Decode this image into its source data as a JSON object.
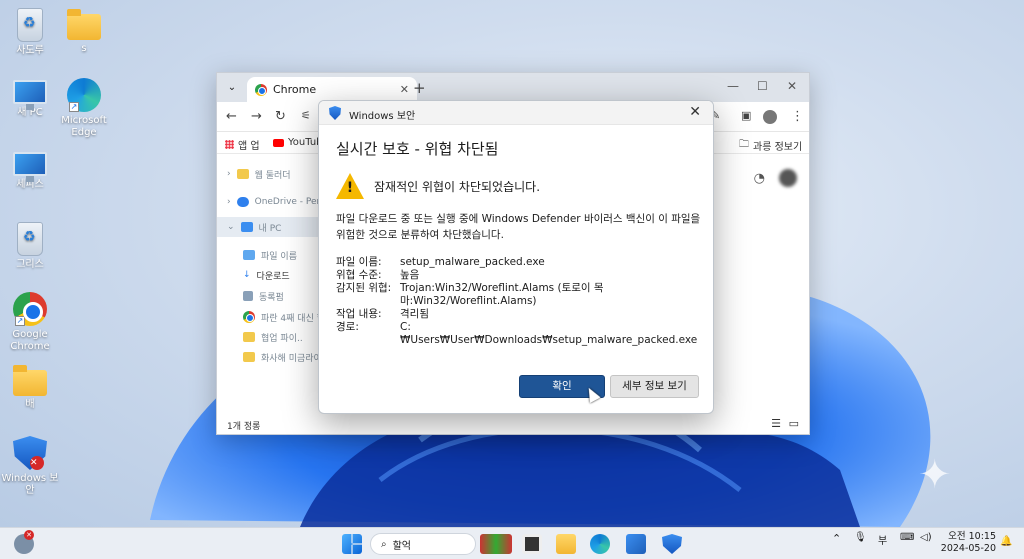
{
  "desktop": {
    "icons": [
      {
        "label": "사도루"
      },
      {
        "label": "s"
      },
      {
        "label": "새 PC"
      },
      {
        "label": "Microsoft Edge"
      },
      {
        "label": "세피스"
      },
      {
        "label": "그리스"
      },
      {
        "label": "Google Chrome"
      },
      {
        "label": "배"
      },
      {
        "label": "Windows 보안"
      }
    ]
  },
  "browser": {
    "tab_title": "Chrome",
    "bookmarks": [
      "앱 업",
      "YouTube",
      "과릉 정보기"
    ],
    "side_items": [
      "웹 둘러더",
      "OneDrive - Pers",
      "내 PC",
      "파일 이름",
      "다운로드",
      "동록펌",
      "파란 4째 대신 합방",
      "협업 파이..",
      "화사해 미금라이"
    ],
    "status": "1개 정롱"
  },
  "dialog": {
    "title": "Windows 보안",
    "heading": "실시간 보호 - 위협 차단됨",
    "subtitle": "잠재적인 위협이 차단되었습니다.",
    "description": "파일 다운로드 중 또는 실행 중에 Windows Defender 바이러스 백신이 이 파일을 위험한 것으로 분류하여 차단했습니다.",
    "details": [
      {
        "key": "파일 이름:",
        "value": "setup_malware_packed.exe"
      },
      {
        "key": "위협 수준:",
        "value": "높음"
      },
      {
        "key": "감지된 위협:",
        "value": "Trojan:Win32/Woreflint.Alams (토로이 목마:Win32/Woreflint.Alams)"
      },
      {
        "key": "작업 내용:",
        "value": "격리됨"
      },
      {
        "key": "경로:",
        "value": "C:₩Users₩User₩Downloads₩setup_malware_packed.exe"
      }
    ],
    "ok_label": "확인",
    "details_label": "세부 정보 보기"
  },
  "taskbar": {
    "search_label": "할억",
    "ime": "부",
    "time": "오전 10:15",
    "date": "2024-05-20"
  }
}
